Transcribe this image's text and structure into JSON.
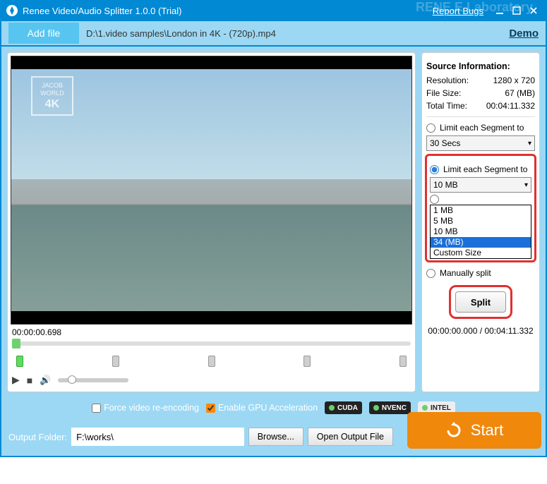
{
  "titlebar": {
    "title": "Renee Video/Audio Splitter 1.0.0 (Trial)",
    "report_label": "Report Bugs",
    "watermark": "RENE.E Laboratory"
  },
  "subbar": {
    "addfile_label": "Add file",
    "filepath": "D:\\1.video samples\\London in 4K - (720p).mp4",
    "demo_label": "Demo"
  },
  "preview": {
    "watermark_line1": "JACOB",
    "watermark_line2": "WORLD",
    "watermark_line3": "4K"
  },
  "timeline": {
    "timecode": "00:00:00.698",
    "total": "00:00:00.000 / 00:04:11.332"
  },
  "info": {
    "heading": "Source Information:",
    "resolution_label": "Resolution:",
    "resolution_value": "1280 x 720",
    "filesize_label": "File Size:",
    "filesize_value": "67 (MB)",
    "totaltime_label": "Total Time:",
    "totaltime_value": "00:04:11.332"
  },
  "options": {
    "limit_time_label": "Limit each Segment to",
    "limit_time_value": "30 Secs",
    "limit_size_label": "Limit each Segment to",
    "limit_size_value": "10 MB",
    "size_options": [
      "1 MB",
      "5 MB",
      "10 MB",
      "34 (MB)",
      "Custom Size"
    ],
    "size_selected_index": 3,
    "manual_label": "Manually split",
    "split_button": "Split"
  },
  "encode": {
    "force_label": "Force video re-encoding",
    "gpu_label": "Enable GPU Acceleration",
    "badges": [
      "CUDA",
      "NVENC",
      "INTEL"
    ]
  },
  "output": {
    "label": "Output Folder:",
    "path": "F:\\works\\",
    "browse_label": "Browse...",
    "open_label": "Open Output File",
    "start_label": "Start"
  }
}
